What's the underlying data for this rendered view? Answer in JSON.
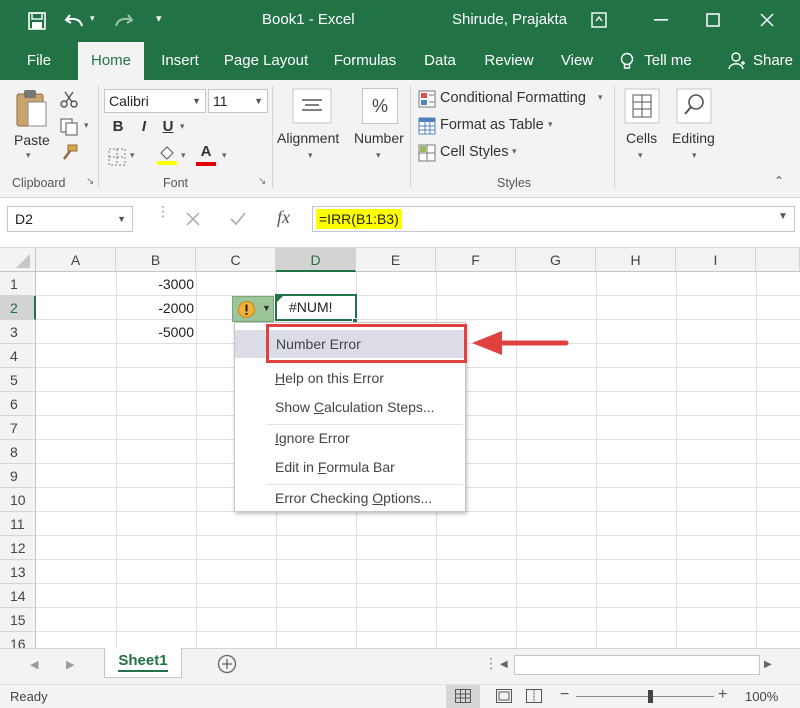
{
  "title_bar": {
    "doc_title": "Book1  -  Excel",
    "user": "Shirude, Prajakta",
    "save_icon": "save-icon",
    "undo_icon": "undo-icon",
    "redo_icon": "redo-icon"
  },
  "tabs": [
    "File",
    "Home",
    "Insert",
    "Page Layout",
    "Formulas",
    "Data",
    "Review",
    "View"
  ],
  "tell_me": "Tell me",
  "share": "Share",
  "ribbon": {
    "clipboard": {
      "paste": "Paste",
      "label": "Clipboard"
    },
    "font": {
      "name": "Calibri",
      "size": "11",
      "bold": "B",
      "italic": "I",
      "underline": "U",
      "label": "Font",
      "font_color_letter": "A"
    },
    "alignment": {
      "label": "Alignment"
    },
    "number": {
      "label": "Number",
      "symbol": "%"
    },
    "styles": {
      "conditional_formatting": "Conditional Formatting",
      "format_as_table": "Format as Table",
      "cell_styles": "Cell Styles",
      "label": "Styles"
    },
    "cells": {
      "label": "Cells"
    },
    "editing": {
      "label": "Editing"
    }
  },
  "formula_bar": {
    "name_box": "D2",
    "fx": "fx",
    "formula": "=IRR(B1:B3)"
  },
  "columns": [
    "A",
    "B",
    "C",
    "D",
    "E",
    "F",
    "G",
    "H",
    "I"
  ],
  "rows": [
    "1",
    "2",
    "3",
    "4",
    "5",
    "6",
    "7",
    "8",
    "9",
    "10",
    "11",
    "12",
    "13",
    "14",
    "15",
    "16"
  ],
  "cells": {
    "B1": "-3000",
    "B2": "-2000",
    "B3": "-5000",
    "D2": "#NUM!"
  },
  "error_menu": {
    "items": [
      "Number Error",
      "Help on this Error",
      "Show Calculation Steps...",
      "Ignore Error",
      "Edit in Formula Bar",
      "Error Checking Options..."
    ]
  },
  "sheet_tabs": [
    "Sheet1"
  ],
  "status": {
    "ready": "Ready",
    "zoom": "100%"
  },
  "colors": {
    "excel_green": "#217346",
    "highlight_yellow": "#ffff00",
    "annotation_red": "#e04040",
    "menu_highlight": "#d4d4e0"
  }
}
